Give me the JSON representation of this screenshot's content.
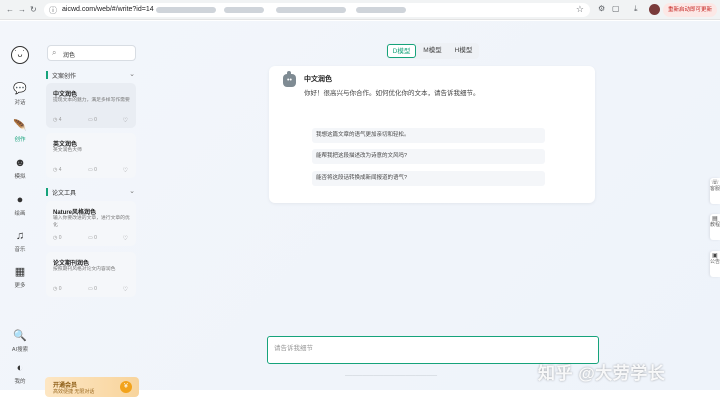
{
  "browser": {
    "url": "aicwd.com/web/#/write?id=14",
    "update_label": "重新启动即可更新"
  },
  "rail": {
    "items": [
      {
        "label": "对话",
        "icon": "chat-icon"
      },
      {
        "label": "创作",
        "icon": "feather-icon"
      },
      {
        "label": "模拟",
        "icon": "mask-icon"
      },
      {
        "label": "绘画",
        "icon": "palette-icon"
      },
      {
        "label": "音乐",
        "icon": "music-icon"
      },
      {
        "label": "更多",
        "icon": "grid-icon"
      },
      {
        "label": "AI搜索",
        "icon": "search-icon"
      },
      {
        "label": "我的",
        "icon": "user-icon"
      }
    ]
  },
  "sidebar": {
    "search_value": "润色",
    "groups": [
      {
        "label": "文案创作"
      },
      {
        "label": "论文工具"
      }
    ],
    "cards": [
      {
        "title": "中文润色",
        "desc": "提现文本的魅力，满足多样写作需要",
        "uses": "4",
        "comments": "0"
      },
      {
        "title": "英文润色",
        "desc": "英文润色大师",
        "uses": "4",
        "comments": "0"
      },
      {
        "title": "Nature风格润色",
        "desc": "输入你要改进的文章，进行文章的优化",
        "uses": "0",
        "comments": "0"
      },
      {
        "title": "论文期刊润色",
        "desc": "按照期刊风格对论文内容润色",
        "uses": "0",
        "comments": "0"
      }
    ],
    "promo": {
      "title": "开通会员",
      "subtitle": "高效便捷 无限对话",
      "button": "¥"
    }
  },
  "models": [
    "D模型",
    "M模型",
    "H模型"
  ],
  "panel": {
    "title": "中文润色",
    "greeting": "你好！很高兴与你合作。如何优化你的文本，请告诉我细节。",
    "suggestions": [
      "我想这篇文章的语气更加亲切和轻松。",
      "能帮我把这段描述改为诗意的文风吗?",
      "能否将这段话转换成新闻报道的语气?"
    ]
  },
  "composer": {
    "placeholder": "请告诉我细节"
  },
  "right_tabs": [
    "客服",
    "教程",
    "公告"
  ],
  "watermark": "知乎 @大劳学长"
}
